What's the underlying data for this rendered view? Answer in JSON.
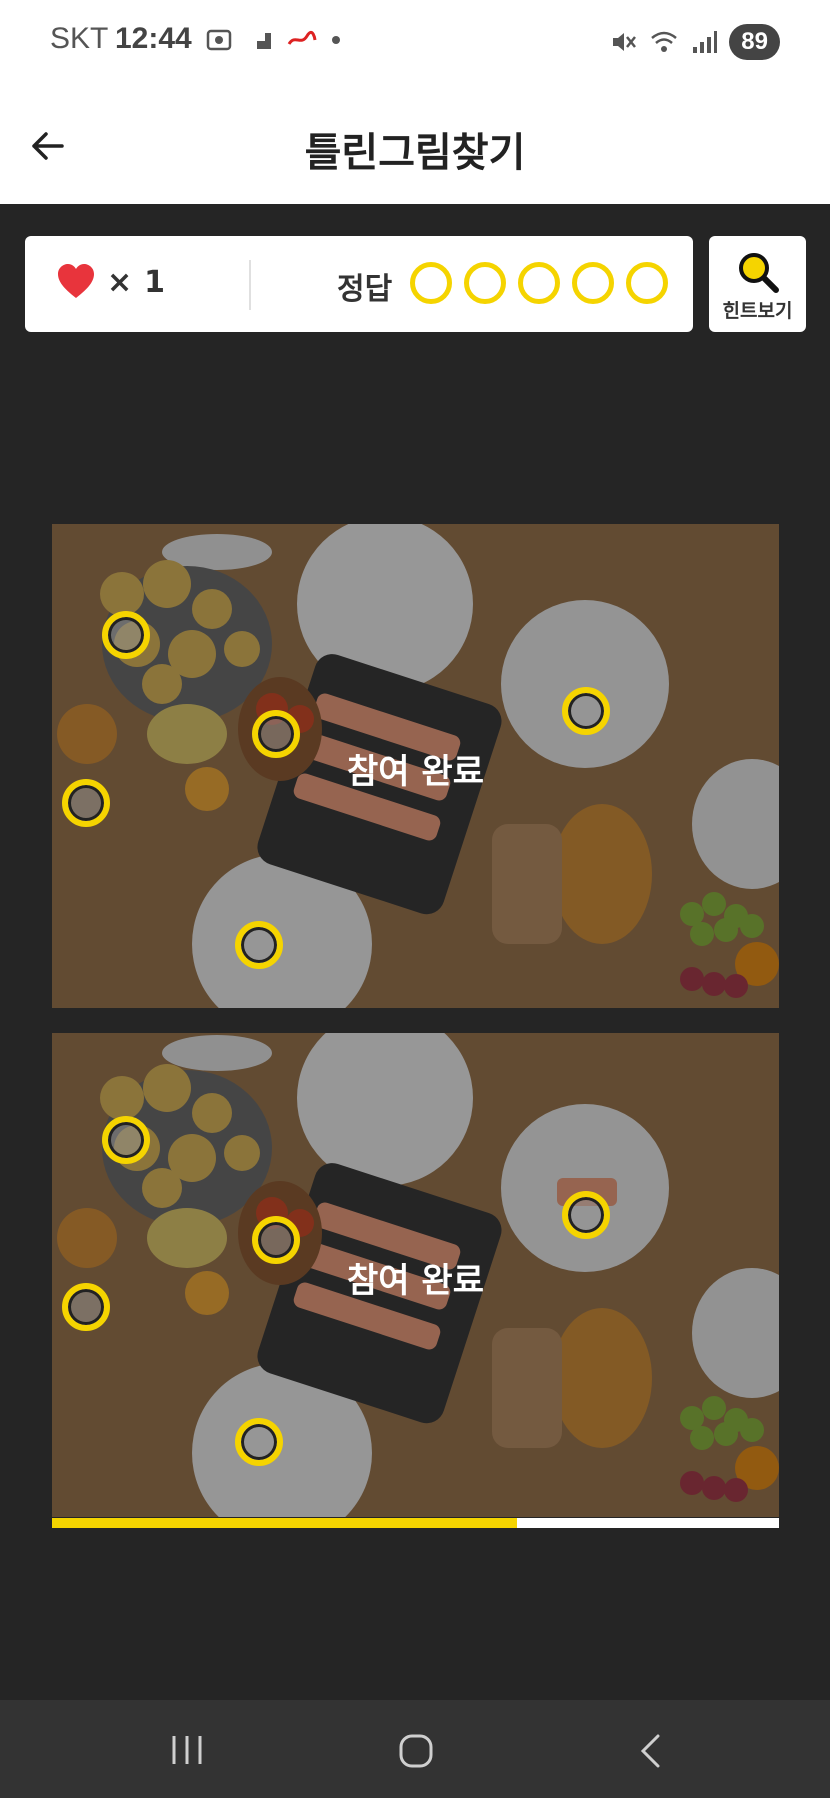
{
  "status_bar": {
    "carrier": "SKT",
    "time": "12:44",
    "battery": "89"
  },
  "header": {
    "title": "틀린그림찾기"
  },
  "score": {
    "lives_prefix": "×",
    "lives_count": "1",
    "answer_label": "정답",
    "answers_total": 5
  },
  "hint": {
    "label": "힌트보기"
  },
  "images": {
    "top_overlay_text": "참여 완료",
    "bottom_overlay_text": "참여 완료"
  },
  "progress": {
    "fraction": 0.64
  },
  "colors": {
    "accent": "#f5d400",
    "heart": "#e8343c",
    "background": "#252525"
  }
}
